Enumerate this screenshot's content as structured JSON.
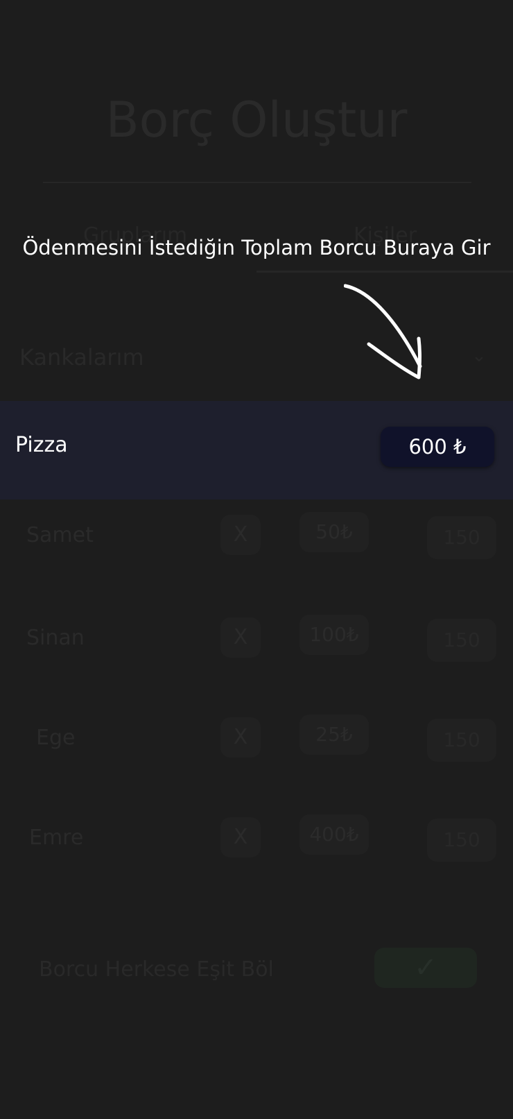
{
  "screen": {
    "title": "Borç Oluştur",
    "tabs": [
      "Gruplarım",
      "Kişiler"
    ],
    "section_label": "Kankalarım",
    "rows": [
      {
        "name": "Samet",
        "remove": "X",
        "amount": "50₺",
        "share": "150"
      },
      {
        "name": "Sinan",
        "remove": "X",
        "amount": "100₺",
        "share": "150"
      },
      {
        "name": "Ege",
        "remove": "X",
        "amount": "25₺",
        "share": "150"
      },
      {
        "name": "Emre",
        "remove": "X",
        "amount": "400₺",
        "share": "150"
      }
    ],
    "split_label": "Borcu Herkese Eşit Böl"
  },
  "tutorial": {
    "hint": "Ödenmesini İstediğin Toplam Borcu Buraya Gir",
    "topic_name": "Pizza",
    "total_value": "600 ₺"
  },
  "colors": {
    "background": "#1d1d1d",
    "highlight_bar": "#1e1f2d",
    "pill": "#10122a",
    "text": "#ffffff"
  }
}
